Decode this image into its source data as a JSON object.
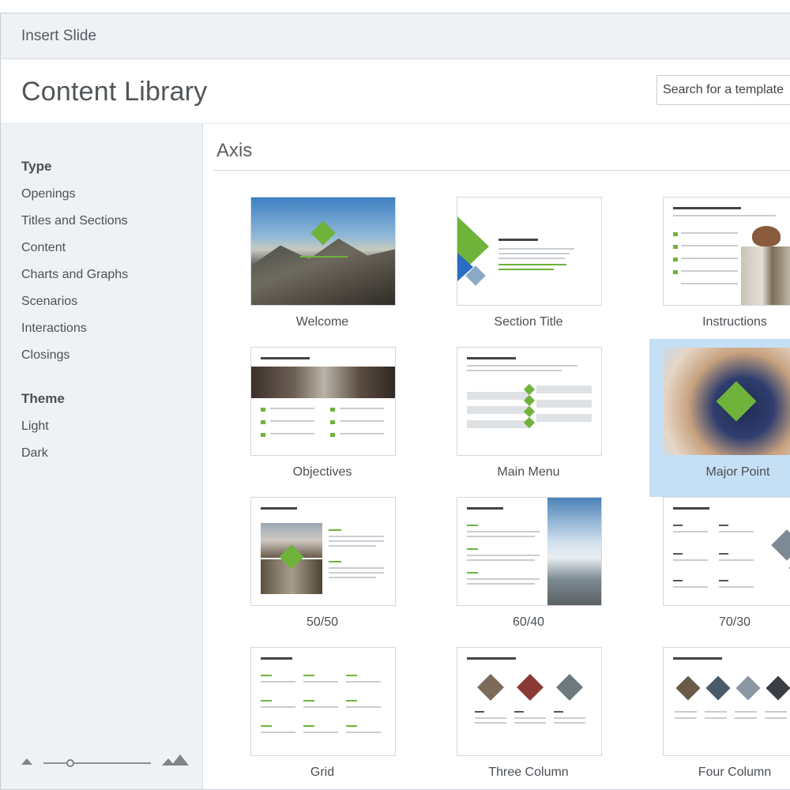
{
  "window": {
    "title": "Insert Slide"
  },
  "header": {
    "title": "Content Library",
    "search_placeholder": "Search for a template"
  },
  "sidebar": {
    "type_heading": "Type",
    "type_items": [
      "Openings",
      "Titles and Sections",
      "Content",
      "Charts and Graphs",
      "Scenarios",
      "Interactions",
      "Closings"
    ],
    "theme_heading": "Theme",
    "theme_items": [
      "Light",
      "Dark"
    ]
  },
  "zoom": {
    "level": 0.25
  },
  "main": {
    "section_title": "Axis",
    "templates": [
      {
        "label": "Welcome",
        "selected": false
      },
      {
        "label": "Section Title",
        "selected": false
      },
      {
        "label": "Instructions",
        "selected": false
      },
      {
        "label": "Objectives",
        "selected": false
      },
      {
        "label": "Main Menu",
        "selected": false
      },
      {
        "label": "Major Point",
        "selected": true
      },
      {
        "label": "50/50",
        "selected": false
      },
      {
        "label": "60/40",
        "selected": false
      },
      {
        "label": "70/30",
        "selected": false
      },
      {
        "label": "Grid",
        "selected": false
      },
      {
        "label": "Three Column",
        "selected": false
      },
      {
        "label": "Four Column",
        "selected": false
      }
    ]
  },
  "colors": {
    "accent_green": "#6fb33b",
    "selection": "#c5dff4",
    "sidebar_bg": "#eff2f5"
  }
}
